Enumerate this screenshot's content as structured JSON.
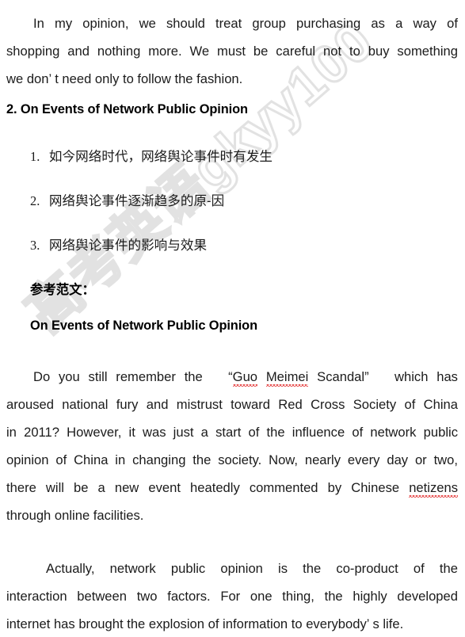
{
  "document": {
    "watermark": "高考英语gkyy100",
    "paragraph_1": {
      "name": "opinion-paragraph",
      "lines": [
        "In my opinion, we should treat group purchasing as a way of",
        "shopping and nothing more. We must be careful not to buy something",
        "we don’  t need only to follow the fashion."
      ],
      "full_text": "In my opinion, we should treat group purchasing as a way of shopping and nothing more. We must be careful not to buy something we don’t need only to follow the fashion."
    },
    "section_heading": "2. On Events of Network Public Opinion",
    "outline_list": [
      {
        "number": "1.",
        "text": "如今网络时代，网络舆论事件时有发生"
      },
      {
        "number": "2.",
        "text": "网络舆论事件逐渐趋多的原-因"
      },
      {
        "number": "3.",
        "text": "网络舆论事件的影响与效果"
      }
    ],
    "sample_label": "参考范文：",
    "essay_title": "On Events of Network Public Opinion",
    "paragraph_2": {
      "name": "essay-paragraph-one",
      "segments": {
        "l1_a": "Do you still remember the",
        "l1_quote_open": "“",
        "l1_spell_1": "Guo",
        "l1_spell_2": "Meimei",
        "l1_plain": "Scandal",
        "l1_quote_close": "”",
        "l1_b": "which has",
        "l2": "aroused national fury and mistrust toward Red Cross Society of China",
        "l3": "in 2011? However, it was just a start of the influence of network public",
        "l4": "opinion of China in changing the society. Now, nearly every day or two,",
        "l5_a": "there will be a new event heatedly commented by Chinese",
        "l5_spell": "netizens",
        "l6": "through online facilities."
      },
      "full_text": "Do you still remember the “Guo Meimei Scandal” which has aroused national fury and mistrust toward Red Cross Society of China in 2011? However, it was just a start of the influence of network public opinion of China in changing the society. Now, nearly every day or two, there will be a new event heatedly commented by Chinese netizens through online facilities."
    },
    "paragraph_3": {
      "name": "essay-paragraph-two",
      "lines": [
        "Actually, network public opinion is the co-product of the",
        "interaction between two factors. For one thing, the highly developed",
        "internet has brought the explosion of information to everybody’  s life."
      ],
      "full_text": "Actually, network public opinion is the co-product of the interaction between two factors. For one thing, the highly developed internet has brought the explosion of information to everybody’s life."
    }
  }
}
